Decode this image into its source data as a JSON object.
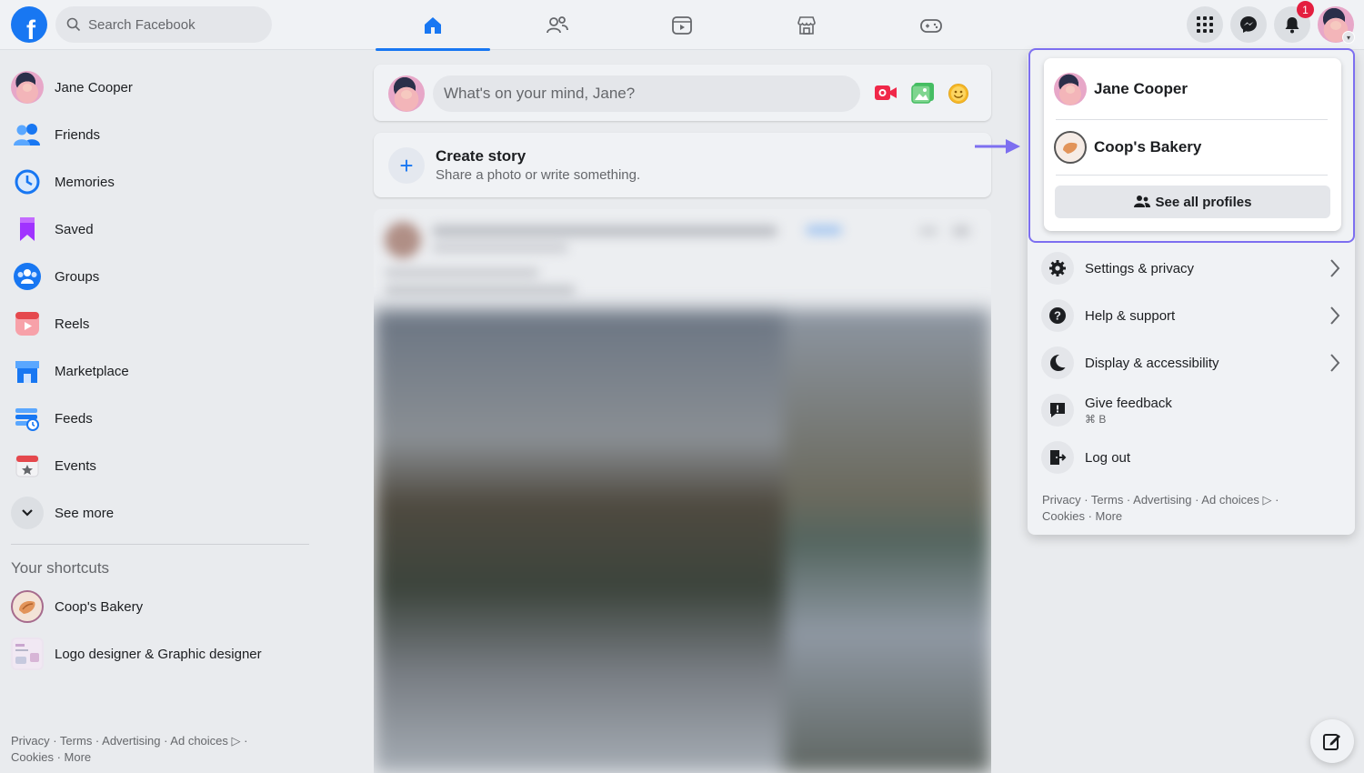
{
  "app": {
    "name": "Facebook"
  },
  "header": {
    "search_placeholder": "Search Facebook",
    "nav_tabs": [
      {
        "name": "home",
        "active": true
      },
      {
        "name": "friends",
        "active": false
      },
      {
        "name": "watch",
        "active": false
      },
      {
        "name": "marketplace",
        "active": false
      },
      {
        "name": "gaming",
        "active": false
      }
    ],
    "notification_count": "1"
  },
  "sidebar": {
    "items": [
      {
        "label": "Jane Cooper",
        "icon": "avatar"
      },
      {
        "label": "Friends",
        "icon": "friends-icon"
      },
      {
        "label": "Memories",
        "icon": "memories-icon"
      },
      {
        "label": "Saved",
        "icon": "saved-icon"
      },
      {
        "label": "Groups",
        "icon": "groups-icon"
      },
      {
        "label": "Reels",
        "icon": "reels-icon"
      },
      {
        "label": "Marketplace",
        "icon": "marketplace-icon"
      },
      {
        "label": "Feeds",
        "icon": "feeds-icon"
      },
      {
        "label": "Events",
        "icon": "events-icon"
      },
      {
        "label": "See more",
        "icon": "chevron-down-icon"
      }
    ],
    "shortcuts_title": "Your shortcuts",
    "shortcuts": [
      {
        "label": "Coop's Bakery"
      },
      {
        "label": "Logo designer & Graphic designer"
      }
    ],
    "footer_line1": "Privacy · Terms · Advertising · Ad choices ▷ ·",
    "footer_line2": "Cookies · More"
  },
  "composer": {
    "placeholder": "What's on your mind, Jane?"
  },
  "story": {
    "title": "Create story",
    "subtitle": "Share a photo or write something."
  },
  "account_menu": {
    "profiles": [
      {
        "name": "Jane Cooper"
      },
      {
        "name": "Coop's Bakery"
      }
    ],
    "see_all_label": "See all profiles",
    "items": [
      {
        "label": "Settings & privacy",
        "icon": "gear-icon",
        "chevron": true
      },
      {
        "label": "Help & support",
        "icon": "help-icon",
        "chevron": true
      },
      {
        "label": "Display & accessibility",
        "icon": "moon-icon",
        "chevron": true
      },
      {
        "label": "Give feedback",
        "sub": "⌘ B",
        "icon": "feedback-icon",
        "chevron": false
      },
      {
        "label": "Log out",
        "icon": "logout-icon",
        "chevron": false
      }
    ],
    "footer_line1": "Privacy · Terms · Advertising · Ad choices ▷ ·",
    "footer_line2": "Cookies · More"
  },
  "colors": {
    "brand_blue": "#1877f2",
    "highlight_purple": "#7d6ff0",
    "badge_red": "#e41e3f"
  }
}
